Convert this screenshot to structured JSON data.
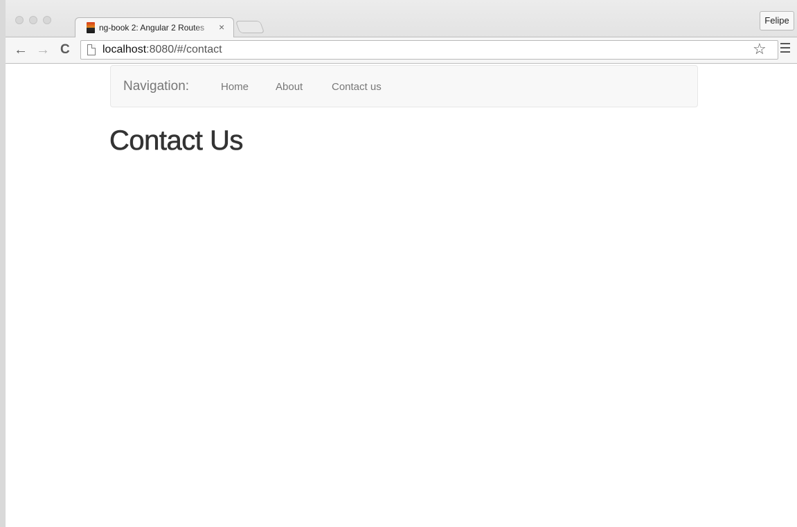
{
  "browser": {
    "tab": {
      "title": "ng-book 2: Angular 2 Routes",
      "close_symbol": "×",
      "favicon": "ng-book-favicon"
    },
    "profile_name": "Felipe",
    "url": {
      "host": "localhost",
      "rest": ":8080/#/contact"
    },
    "icons": {
      "back": "←",
      "forward": "→",
      "reload": "C",
      "bookmark": "☆"
    }
  },
  "page": {
    "navbar": {
      "brand": "Navigation:",
      "links": [
        {
          "label": "Home"
        },
        {
          "label": "About"
        },
        {
          "label": "Contact us"
        }
      ]
    },
    "heading": "Contact Us"
  },
  "colors": {
    "navbar_bg": "#f8f8f8",
    "navbar_text": "#777777",
    "heading_text": "#333333"
  }
}
